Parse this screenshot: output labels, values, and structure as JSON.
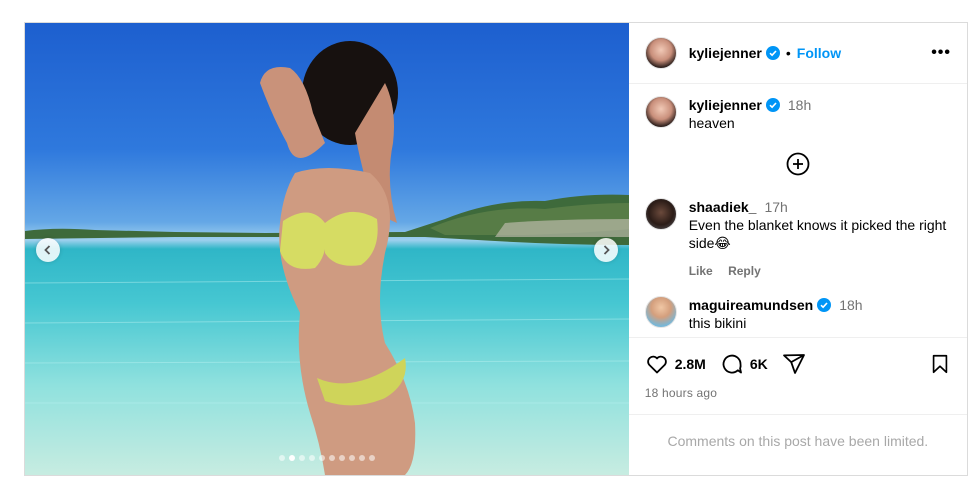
{
  "post": {
    "author": "kyliejenner",
    "follow_sep": "•",
    "follow_label": "Follow",
    "more_label": "•••",
    "caption_author": "kyliejenner",
    "caption_time": "18h",
    "caption_text": "heaven",
    "carousel": {
      "slide_count": 10,
      "active_index": 1
    }
  },
  "comments": [
    {
      "user": "shaadiek_",
      "time": "17h",
      "text": "Even the blanket knows it picked the right side😂",
      "like_label": "Like",
      "reply_label": "Reply"
    },
    {
      "user": "maguireamundsen",
      "time": "18h",
      "text": "this bikini"
    }
  ],
  "stats": {
    "likes": "2.8M",
    "comments": "6K",
    "posted": "18 hours ago",
    "limited_notice": "Comments on this post have been limited."
  },
  "colors": {
    "accent": "#0095f6",
    "muted": "#737373",
    "verified": "#0095f6"
  }
}
